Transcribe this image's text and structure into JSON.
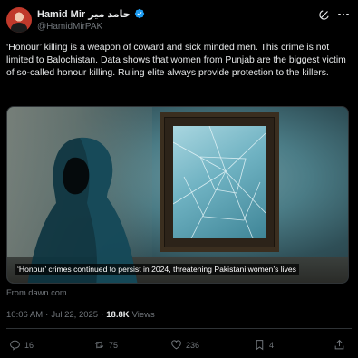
{
  "author": {
    "display_name": "Hamid Mir حامد میر",
    "handle": "@HamidMirPAK",
    "verified": true
  },
  "tweet": {
    "text": "‘Honour’ killing is a weapon of coward and sick minded men. This crime is not limited to Balochistan. Data shows that women from Punjab are the biggest victim of so-called honour killing. Ruling elite always provide protection to the killers."
  },
  "media": {
    "caption": "‘Honour’ crimes continued to persist in 2024, threatening Pakistani women’s lives",
    "source": "From dawn.com"
  },
  "meta": {
    "time": "10:06 AM",
    "separator": "·",
    "date": "Jul 22, 2025",
    "separator2": "·",
    "views_count": "18.8K",
    "views_label": "Views"
  },
  "actions": {
    "replies": "16",
    "reposts": "75",
    "likes": "236",
    "bookmarks": "4"
  },
  "icons": {
    "verified": "verified-badge-icon",
    "grok": "grok-icon",
    "more": "more-icon",
    "reply": "reply-icon",
    "repost": "repost-icon",
    "like": "heart-icon",
    "bookmark": "bookmark-icon",
    "share": "share-icon"
  },
  "colors": {
    "background": "#000000",
    "text": "#e7e9ea",
    "muted": "#71767b",
    "verified": "#1d9bf0",
    "divider": "#2f3336"
  }
}
